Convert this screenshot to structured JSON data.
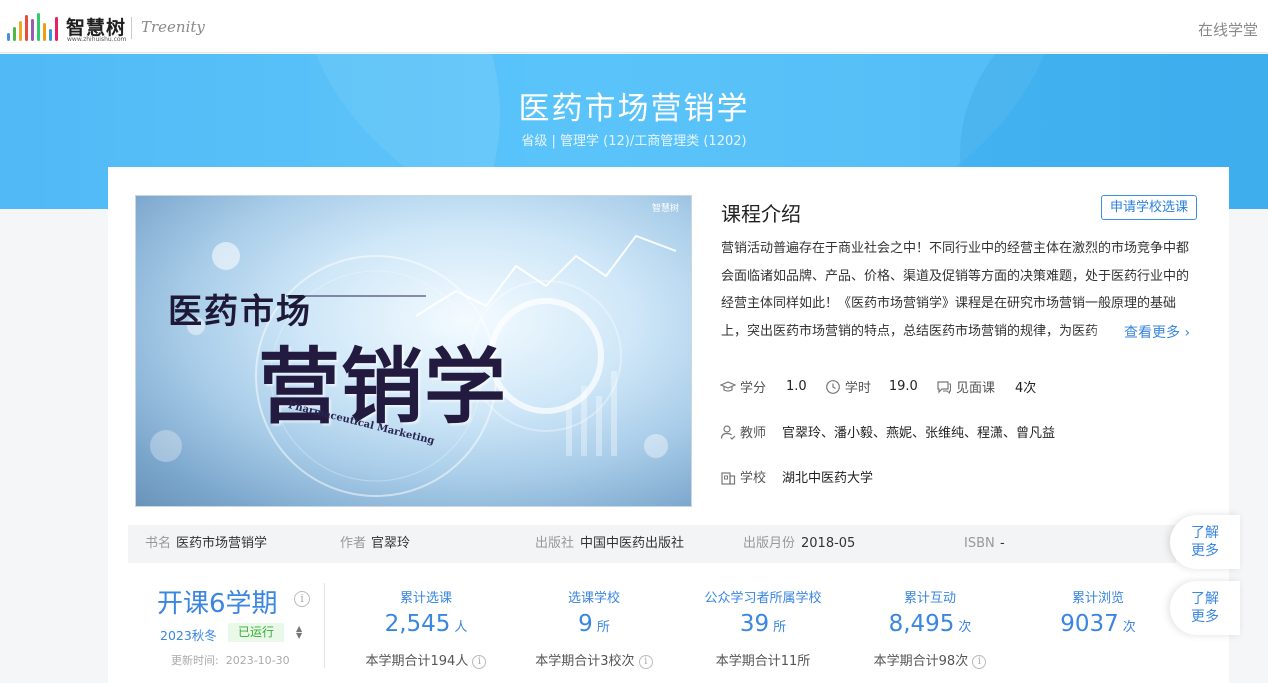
{
  "brand": {
    "name_cn": "智慧树",
    "url_text": "www.zhihuishu.com",
    "partner": "Treenity",
    "bar_colors": [
      "#4a90e2",
      "#50b848",
      "#f5a623",
      "#e74c3c",
      "#9b59b6",
      "#2ecc71",
      "#f39c12",
      "#3498db",
      "#e91e63"
    ]
  },
  "nav": {
    "right_label": "在线学堂"
  },
  "hero": {
    "title": "医药市场营销学",
    "subtitle": "省级 | 管理学 (12)/工商管理类 (1202)"
  },
  "cover": {
    "title_small": "医药市场",
    "title_big": "营销学",
    "title_en": "Pharmaceutical Marketing",
    "logo_text": "智慧树"
  },
  "intro": {
    "heading": "课程介绍",
    "apply_button": "申请学校选课",
    "text": "营销活动普遍存在于商业社会之中！不同行业中的经营主体在激烈的市场竞争中都会面临诸如品牌、产品、价格、渠道及促销等方面的决策难题，处于医药行业中的经营主体同样如此！《医药市场营销学》课程是在研究市场营销一般原理的基础上，突出医药市场营销的特点，总结医药市场营销的规律，为医药",
    "see_more": "查看更多"
  },
  "meta": {
    "credit_label": "学分",
    "credit_value": "1.0",
    "hours_label": "学时",
    "hours_value": "19.0",
    "f2f_label": "见面课",
    "f2f_value": "4次",
    "teacher_label": "教师",
    "teacher_value": "官翠玲、潘小毅、燕妮、张维纯、程潇、曾凡益",
    "school_label": "学校",
    "school_value": "湖北中医药大学"
  },
  "book": {
    "name_label": "书名",
    "name_value": "医药市场营销学",
    "author_label": "作者",
    "author_value": "官翠玲",
    "publisher_label": "出版社",
    "publisher_value": "中国中医药出版社",
    "month_label": "出版月份",
    "month_value": "2018-05",
    "isbn_label": "ISBN",
    "isbn_value": "-"
  },
  "side_buttons": [
    {
      "line1": "了解",
      "line2": "更多"
    },
    {
      "line1": "了解",
      "line2": "更多"
    }
  ],
  "semester": {
    "title": "开课6学期",
    "term": "2023秋冬",
    "status": "已运行",
    "update_label": "更新时间:",
    "update_date": "2023-10-30"
  },
  "stats": [
    {
      "label": "累计选课",
      "value": "2,545",
      "unit": "人",
      "sub": "本学期合计194人",
      "info": true
    },
    {
      "label": "选课学校",
      "value": "9",
      "unit": "所",
      "sub": "本学期合计3校次",
      "info": true
    },
    {
      "label": "公众学习者所属学校",
      "value": "39",
      "unit": "所",
      "sub": "本学期合计11所",
      "info": false
    },
    {
      "label": "累计互动",
      "value": "8,495",
      "unit": "次",
      "sub": "本学期合计98次",
      "info": true
    },
    {
      "label": "累计浏览",
      "value": "9037",
      "unit": "次",
      "sub": "",
      "info": false
    }
  ]
}
